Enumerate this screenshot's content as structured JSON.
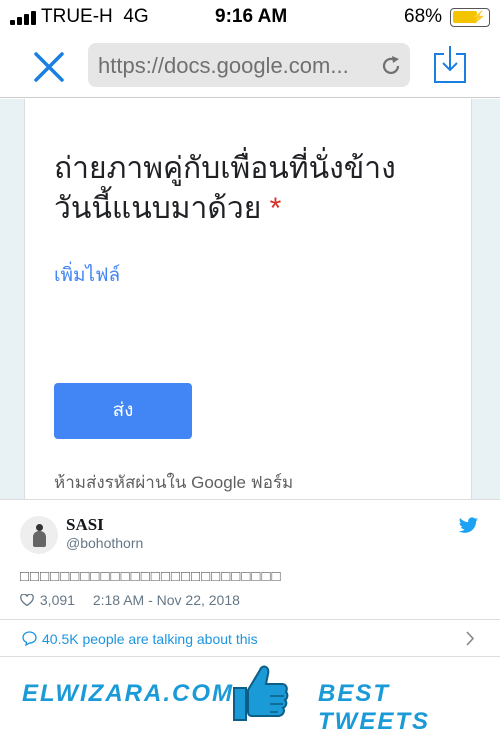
{
  "status_bar": {
    "carrier": "TRUE-H",
    "network": "4G",
    "time": "9:16 AM",
    "battery_percent": "68%",
    "battery_level": 0.68
  },
  "browser": {
    "url": "https://docs.google.com..."
  },
  "form": {
    "question_line1": "ถ่ายภาพคู่กับเพื่อนที่นั่งข้าง",
    "question_line2": "วันนี้แนบมาด้วย",
    "required_mark": "*",
    "add_file": "เพิ่มไฟล์",
    "submit": "ส่ง",
    "warning": "ห้ามส่งรหัสผ่านใน Google ฟอร์ม"
  },
  "tweet": {
    "display_name": "SASI",
    "handle": "@bohothorn",
    "text": "□□□□□□□□□□□□□□□□□□□□□□□□□□",
    "likes": "3,091",
    "timestamp": "2:18 AM - Nov 22, 2018",
    "talking": "40.5K people are talking about this"
  },
  "brand": {
    "left": "ELWIZARA.COM",
    "right": "BEST TWEETS"
  },
  "colors": {
    "google_blue": "#4285f4",
    "required_red": "#d93025",
    "twitter_blue": "#1da1f2",
    "brand_blue": "#1a9ad6"
  }
}
